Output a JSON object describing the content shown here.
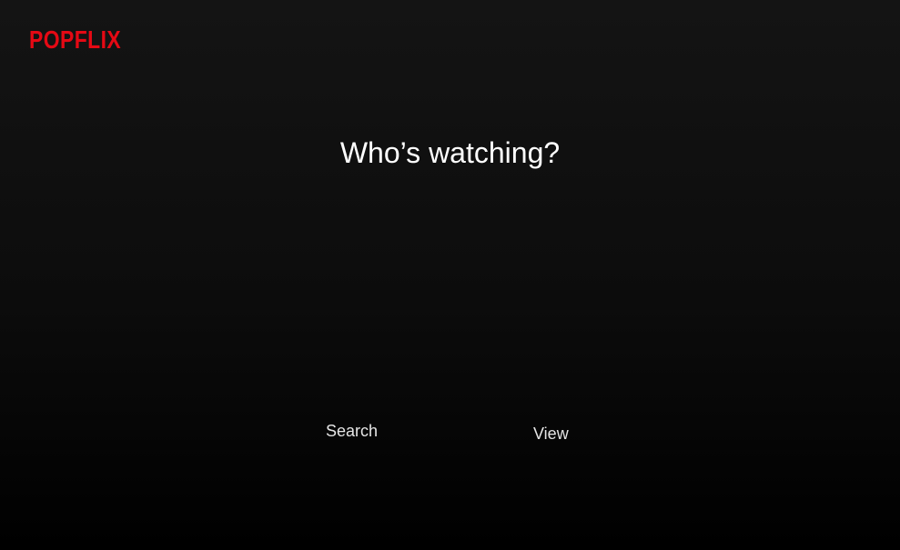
{
  "brand": {
    "logo_text": "POPFLIX",
    "accent_color": "#E50914"
  },
  "page": {
    "title": "Who’s watching?"
  },
  "profiles": [
    {
      "label": "Search"
    },
    {
      "label": "View"
    }
  ]
}
